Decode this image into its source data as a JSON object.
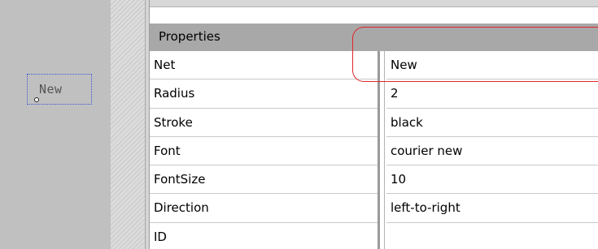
{
  "canvas": {
    "net_label_text": "New"
  },
  "properties": {
    "header": "Properties",
    "rows": [
      {
        "name": "Net",
        "value": "New"
      },
      {
        "name": "Radius",
        "value": "2"
      },
      {
        "name": "Stroke",
        "value": "black"
      },
      {
        "name": "Font",
        "value": "courier new"
      },
      {
        "name": "FontSize",
        "value": "10"
      },
      {
        "name": "Direction",
        "value": "left-to-right"
      },
      {
        "name": "ID",
        "value": ""
      }
    ]
  },
  "colors": {
    "highlight": "#e0262a",
    "selection_border": "#3a57d6",
    "header_bg": "#a8a8a8"
  }
}
